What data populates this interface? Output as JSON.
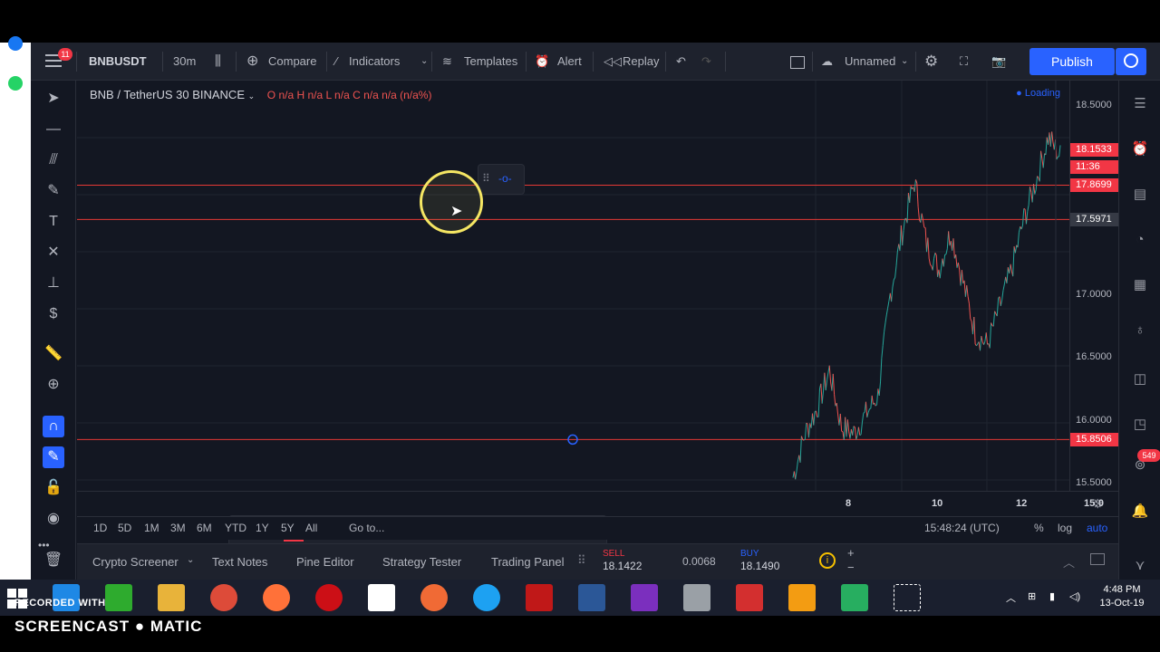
{
  "topbar": {
    "symbol": "BNBUSDT",
    "interval": "30m",
    "compare": "Compare",
    "indicators": "Indicators",
    "templates": "Templates",
    "alert": "Alert",
    "replay": "Replay",
    "layout_name": "Unnamed",
    "publish": "Publish",
    "notif_count": "11"
  },
  "legend": {
    "title": "BNB / TetherUS  30  BINANCE",
    "ohlc": "O n/a  H n/a  L n/a  C n/a  n/a (n/a%)",
    "loading": "Loading"
  },
  "price_axis": {
    "labels": [
      "18.5000",
      "17.0000",
      "16.5000",
      "16.0000",
      "15.5000"
    ],
    "tags": [
      {
        "text": "18.1533",
        "color": "#f23645"
      },
      {
        "text": "11:36",
        "color": "#f23645"
      },
      {
        "text": "17.8699",
        "color": "#f23645"
      },
      {
        "text": "17.5971",
        "color": "#363a45"
      },
      {
        "text": "15.8506",
        "color": "#f23645"
      }
    ],
    "partial_label": "17.5000"
  },
  "time_axis": {
    "labels": [
      "8",
      "10",
      "12",
      "15:0"
    ]
  },
  "range_bar": {
    "ranges": [
      "1D",
      "5D",
      "1M",
      "3M",
      "6M",
      "YTD",
      "1Y",
      "5Y",
      "All"
    ],
    "goto": "Go to...",
    "time": "15:48:24 (UTC)",
    "percent": "%",
    "log": "log",
    "auto": "auto"
  },
  "panel_bar": {
    "tabs": [
      "Crypto Screener",
      "Text Notes",
      "Pine Editor",
      "Strategy Tester",
      "Trading Panel"
    ],
    "sell_label": "SELL",
    "sell_price": "18.1422",
    "spread": "0.0068",
    "buy_label": "BUY",
    "buy_price": "18.1490"
  },
  "right_badge": "549",
  "taskbar": {
    "time": "4:48 PM",
    "date": "13-Oct-19"
  },
  "watermark": {
    "line1": "RECORDED WITH",
    "line2": "SCREENCAST ● MATIC"
  },
  "chart_data": {
    "type": "line",
    "x_labels": [
      "8",
      "10",
      "12",
      "15:0"
    ],
    "horizontal_levels": [
      17.8699,
      17.5971,
      15.8506
    ],
    "ylim": [
      15.3,
      18.7
    ],
    "series": [
      {
        "values": [
          15.55,
          15.9,
          16.1,
          16.4,
          15.95,
          15.9,
          16.05,
          16.2,
          17.0,
          17.5,
          17.9,
          17.4,
          17.2,
          17.5,
          17.1,
          16.7,
          16.6,
          16.9,
          17.2,
          17.6,
          17.9,
          18.25,
          18.1
        ]
      }
    ]
  }
}
